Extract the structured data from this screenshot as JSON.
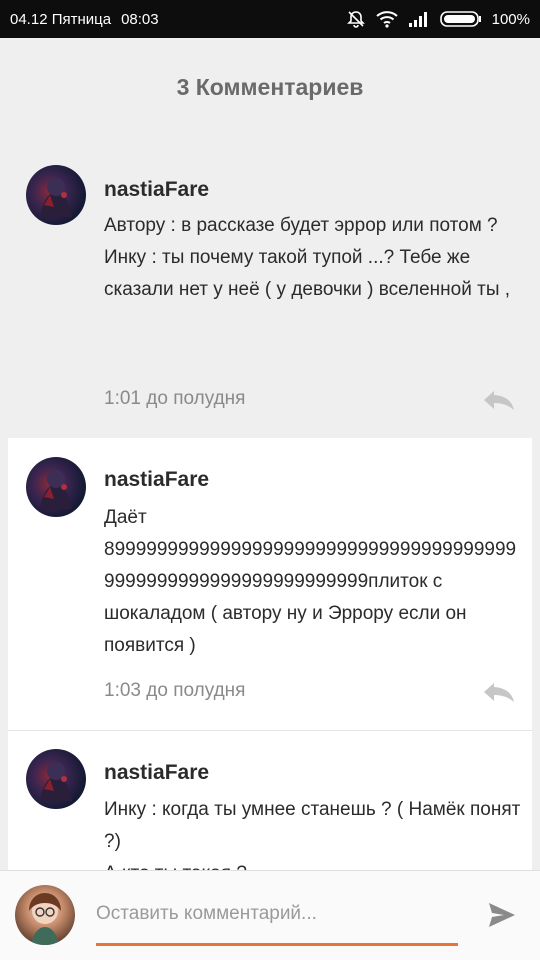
{
  "status_bar": {
    "date": "04.12 Пятница",
    "time": "08:03",
    "battery": "100%"
  },
  "header": {
    "title": "3 Комментариев"
  },
  "comments": [
    {
      "username": "nastiaFare",
      "text": "Автору : в рассказе будет эррор или потом ?\nИнку : ты почему такой тупой ...? Тебе же сказали нет у неё ( у девочки ) вселенной ты ,",
      "time": "1:01 до полудня"
    },
    {
      "username": "nastiaFare",
      "text": "Даёт\n8999999999999999999999999999999999999999999999999999999999999999плиток с шокаладом ( автору  ну и Эррору если он появится )",
      "time": "1:03 до полудня"
    },
    {
      "username": "nastiaFare",
      "text": "Инку : когда ты умнее станешь ? ( Намёк понят ?)\nА кто ты такая ?",
      "time": ""
    }
  ],
  "composer": {
    "placeholder": "Оставить комментарий..."
  },
  "icons": {
    "status": [
      "silent-bell-icon",
      "wifi-icon",
      "signal-icon",
      "battery-icon"
    ],
    "reply": "reply-icon",
    "send": "send-icon"
  },
  "colors": {
    "accent": "#e8743a",
    "status_bar": "#0d0d0d",
    "background": "#efefef"
  }
}
